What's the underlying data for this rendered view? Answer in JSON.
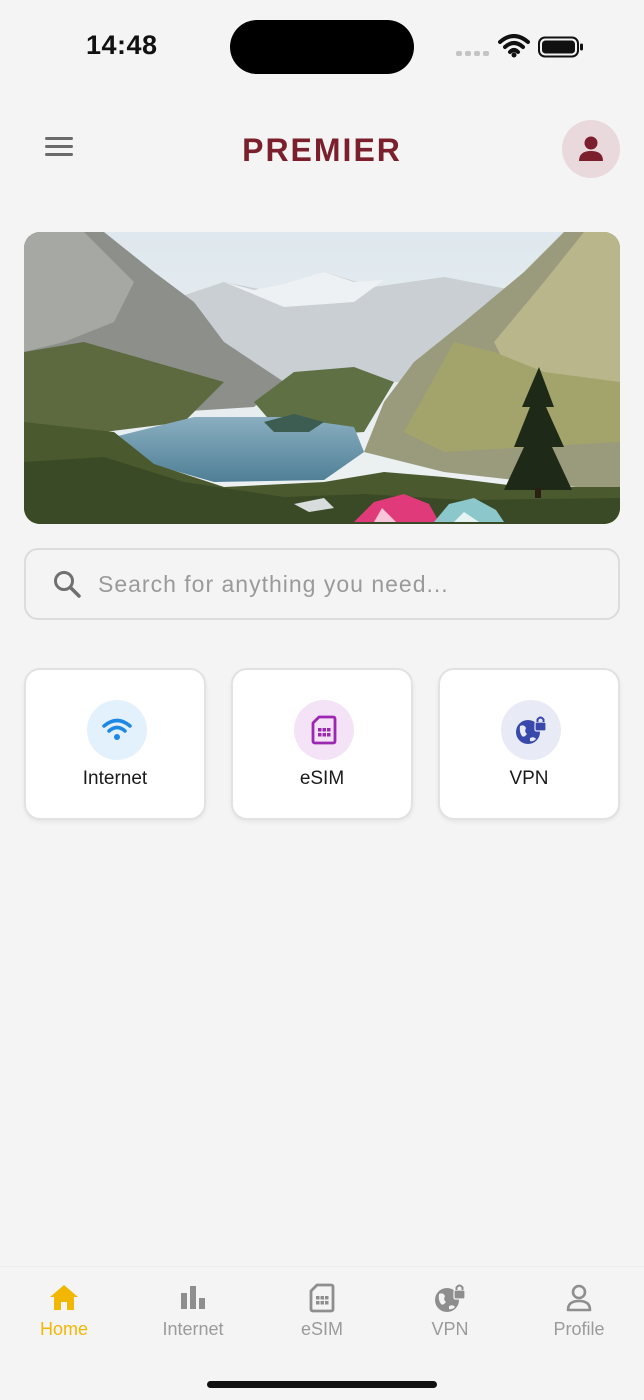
{
  "status_bar": {
    "time": "14:48",
    "icons": [
      "cellular-signal-icon",
      "wifi-icon",
      "battery-icon"
    ]
  },
  "header": {
    "brand": "PREMIER",
    "menu_icon": "hamburger-menu-icon",
    "profile_icon": "user-icon"
  },
  "hero": {
    "description": "banner image"
  },
  "search": {
    "placeholder": "Search for anything you need...",
    "value": "",
    "icon": "search-icon"
  },
  "services": [
    {
      "label": "Internet",
      "icon": "wifi-icon",
      "icon_color": "#1e88e5",
      "icon_bg": "#e3f1fd"
    },
    {
      "label": "eSIM",
      "icon": "sim-card-icon",
      "icon_color": "#9c27b0",
      "icon_bg": "#f4e3f6"
    },
    {
      "label": "VPN",
      "icon": "globe-lock-icon",
      "icon_color": "#3949ab",
      "icon_bg": "#e8eaf6"
    }
  ],
  "bottom_nav": {
    "active": "Home",
    "items": [
      {
        "label": "Home",
        "icon": "home-icon"
      },
      {
        "label": "Internet",
        "icon": "bar-chart-icon"
      },
      {
        "label": "eSIM",
        "icon": "sim-card-icon"
      },
      {
        "label": "VPN",
        "icon": "globe-lock-icon"
      },
      {
        "label": "Profile",
        "icon": "user-outline-icon"
      }
    ]
  },
  "colors": {
    "brand": "#7a1f2b",
    "accent_active": "#f2b705",
    "inactive": "#9b9b9b",
    "background": "#f4f4f4",
    "avatar_bg": "#ead9dc"
  }
}
